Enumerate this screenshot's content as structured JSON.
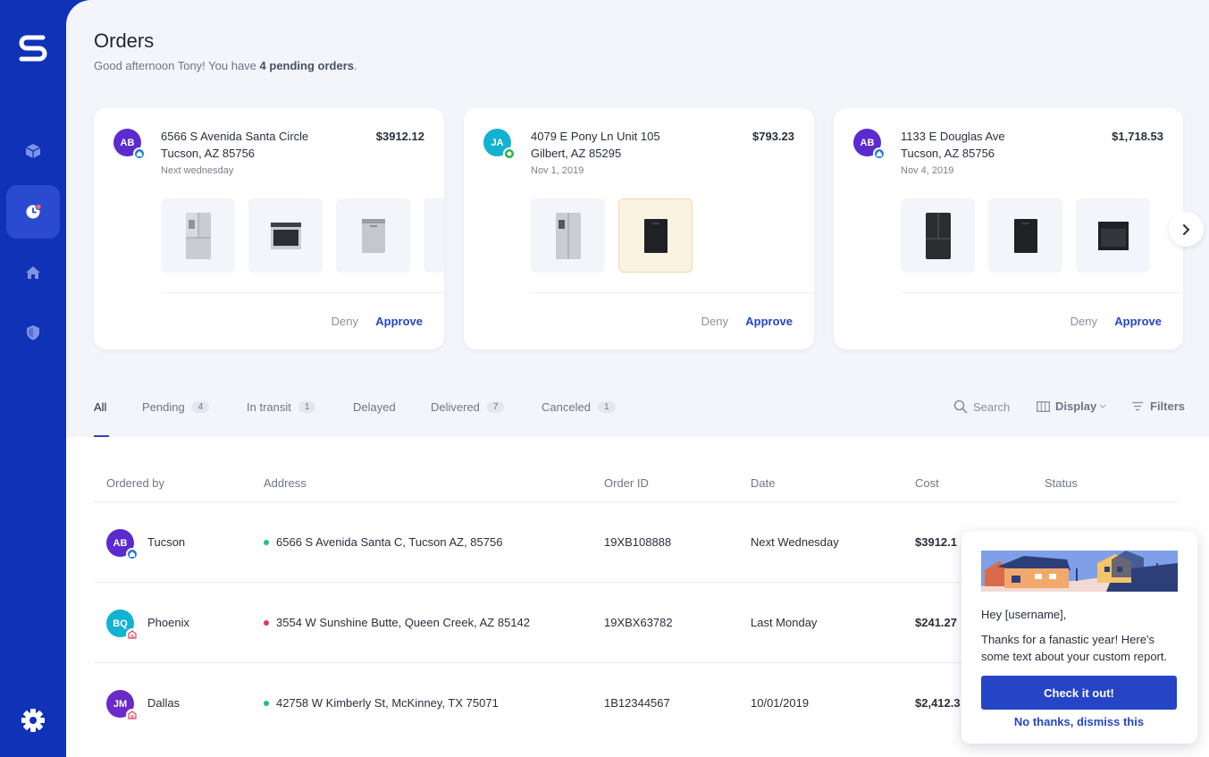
{
  "header": {
    "title": "Orders",
    "greeting_prefix": "Good afternoon Tony! You have ",
    "greeting_bold": "4 pending orders",
    "greeting_suffix": "."
  },
  "cards": [
    {
      "initials": "AB",
      "avatar_color": "#5b2bd0",
      "badge_color": "#1f7ad8",
      "address_line1": "6566 S Avenida Santa Circle",
      "address_line2": "Tucson, AZ 85756",
      "when": "Next wednesday",
      "price": "$3912.12",
      "deny": "Deny",
      "approve": "Approve"
    },
    {
      "initials": "JA",
      "avatar_color": "#12b3d0",
      "badge_color": "#27b24a",
      "address_line1": "4079 E Pony Ln Unit 105",
      "address_line2": "Gilbert, AZ 85295",
      "when": "Nov 1, 2019",
      "price": "$793.23",
      "deny": "Deny",
      "approve": "Approve"
    },
    {
      "initials": "AB",
      "avatar_color": "#5b2bd0",
      "badge_color": "#1f7ad8",
      "address_line1": "1133 E Douglas Ave",
      "address_line2": "Tucson, AZ 85756",
      "when": "Nov 4, 2019",
      "price": "$1,718.53",
      "deny": "Deny",
      "approve": "Approve"
    }
  ],
  "tabs": [
    {
      "label": "All",
      "count": ""
    },
    {
      "label": "Pending",
      "count": "4"
    },
    {
      "label": "In transit",
      "count": "1"
    },
    {
      "label": "Delayed",
      "count": ""
    },
    {
      "label": "Delivered",
      "count": "7"
    },
    {
      "label": "Canceled",
      "count": "1"
    }
  ],
  "tools": {
    "search": "Search",
    "display": "Display",
    "filters": "Filters"
  },
  "table": {
    "columns": [
      "Ordered by",
      "Address",
      "Order ID",
      "Date",
      "Cost",
      "Status"
    ],
    "rows": [
      {
        "initials": "AB",
        "avatar_color": "#5b2bd0",
        "badge_color": "#1f7ad8",
        "city": "Tucson",
        "dot_color": "#22c07a",
        "address": "6566 S Avenida Santa C, Tucson AZ, 85756",
        "order_id": "19XB108888",
        "date": "Next Wednesday",
        "cost": "$3912.1"
      },
      {
        "initials": "BQ",
        "avatar_color": "#12b3d0",
        "badge_color": "#e0405a",
        "city": "Phoenix",
        "dot_color": "#e23b54",
        "address": "3554 W Sunshine Butte, Queen Creek, AZ 85142",
        "order_id": "19XBX63782",
        "date": "Last Monday",
        "cost": "$241.27"
      },
      {
        "initials": "JM",
        "avatar_color": "#6a2bc8",
        "badge_color": "#e0405a",
        "city": "Dallas",
        "dot_color": "#22c07a",
        "address": "42758 W Kimberly St, McKinney, TX 75071",
        "order_id": "1B12344567",
        "date": "10/01/2019",
        "cost": "$2,412.3"
      }
    ]
  },
  "popup": {
    "greeting": "Hey [username],",
    "message": "Thanks for a fanastic year!  Here's some text about your custom report.",
    "cta": "Check it out!",
    "dismiss": "No thanks, dismiss this"
  },
  "icons": {
    "logo": "logo-s-icon",
    "nav": [
      "package-icon",
      "clock-icon",
      "home-icon",
      "shield-icon"
    ],
    "settings": "gear-icon"
  },
  "colors": {
    "brand": "#0f32b7",
    "accent": "#2645c6"
  }
}
